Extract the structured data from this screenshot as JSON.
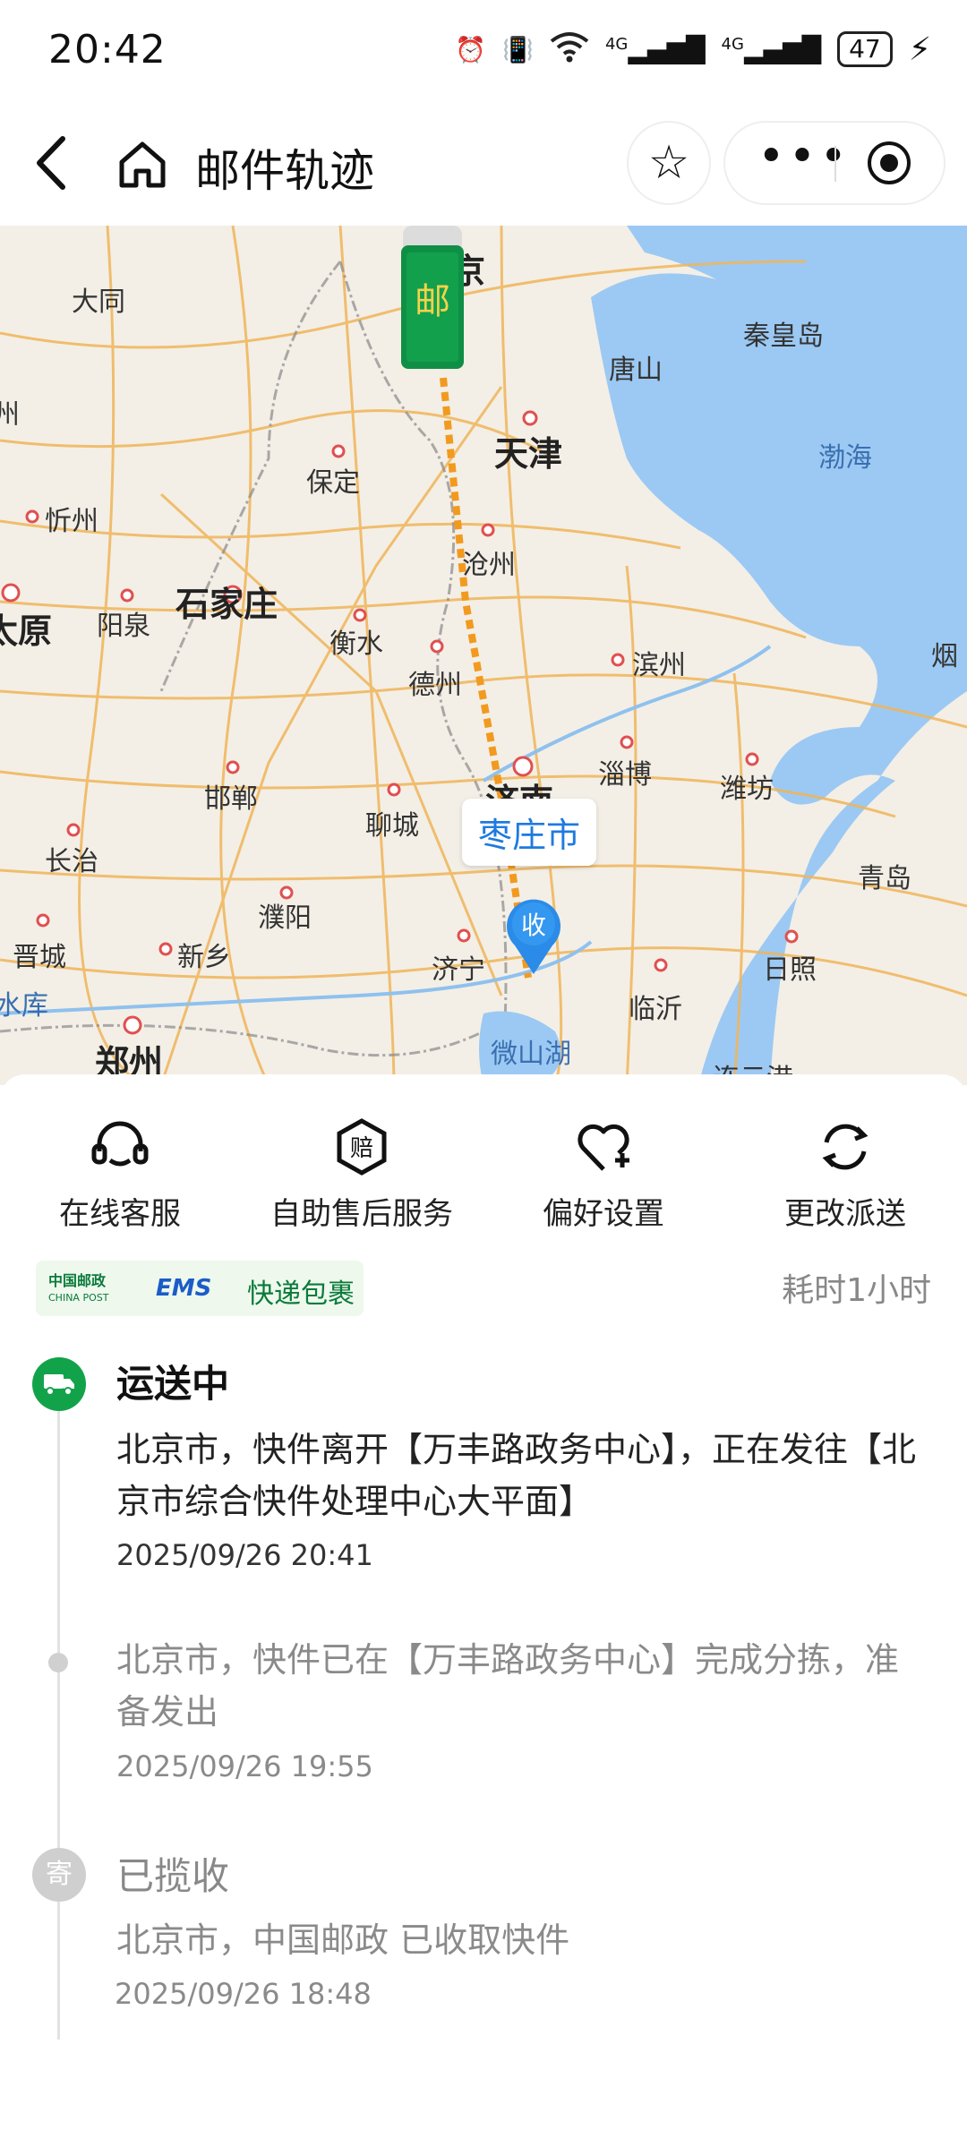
{
  "status_bar": {
    "time": "20:42",
    "network1": "4G",
    "network2": "4G",
    "battery": "47"
  },
  "nav": {
    "title": "邮件轨迹"
  },
  "map": {
    "destination_label": "枣庄市",
    "pin_label": "收",
    "cities": [
      {
        "name": "大同",
        "cls": ""
      },
      {
        "name": "秦皇岛",
        "cls": ""
      },
      {
        "name": "唐山",
        "cls": ""
      },
      {
        "name": "天津",
        "cls": "big"
      },
      {
        "name": "渤海",
        "cls": "water"
      },
      {
        "name": "保定",
        "cls": ""
      },
      {
        "name": "忻州",
        "cls": ""
      },
      {
        "name": "沧州",
        "cls": ""
      },
      {
        "name": "石家庄",
        "cls": "big"
      },
      {
        "name": "阳泉",
        "cls": ""
      },
      {
        "name": "太原",
        "cls": "big"
      },
      {
        "name": "衡水",
        "cls": ""
      },
      {
        "name": "德州",
        "cls": ""
      },
      {
        "name": "滨州",
        "cls": ""
      },
      {
        "name": "淄博",
        "cls": ""
      },
      {
        "name": "潍坊",
        "cls": ""
      },
      {
        "name": "邯郸",
        "cls": ""
      },
      {
        "name": "聊城",
        "cls": ""
      },
      {
        "name": "济南",
        "cls": "big"
      },
      {
        "name": "长治",
        "cls": ""
      },
      {
        "name": "青岛",
        "cls": ""
      },
      {
        "name": "濮阳",
        "cls": ""
      },
      {
        "name": "晋城",
        "cls": ""
      },
      {
        "name": "新乡",
        "cls": ""
      },
      {
        "name": "济宁",
        "cls": ""
      },
      {
        "name": "日照",
        "cls": ""
      },
      {
        "name": "临沂",
        "cls": ""
      },
      {
        "name": "水库",
        "cls": "water"
      },
      {
        "name": "郑州",
        "cls": "big"
      },
      {
        "name": "微山湖",
        "cls": "water"
      },
      {
        "name": "连云港",
        "cls": ""
      },
      {
        "name": "烟",
        "cls": ""
      },
      {
        "name": "州",
        "cls": ""
      },
      {
        "name": "京",
        "cls": "big"
      }
    ]
  },
  "actions": [
    {
      "label": "在线客服",
      "icon": "headset-icon"
    },
    {
      "label": "自助售后服务",
      "icon": "compensation-icon"
    },
    {
      "label": "偏好设置",
      "icon": "heart-plus-icon"
    },
    {
      "label": "更改派送",
      "icon": "refresh-icon"
    }
  ],
  "carrier": {
    "post_cn": "中国邮政",
    "post_en": "CHINA POST",
    "ems": "EMS",
    "type": "快递包裹"
  },
  "duration": "耗时1小时",
  "timeline": [
    {
      "title": "运送中",
      "text": "北京市，快件离开【万丰路政务中心】，正在发往【北京市综合快件处理中心大平面】",
      "time": "2025/09/26 20:41"
    },
    {
      "title": "",
      "text": "北京市，快件已在【万丰路政务中心】完成分拣，准备发出",
      "time": "2025/09/26 19:55"
    },
    {
      "title": "已揽收",
      "icon_label": "寄",
      "text": "北京市，中国邮政 已收取快件",
      "time": "2025/09/26 18:48"
    }
  ]
}
